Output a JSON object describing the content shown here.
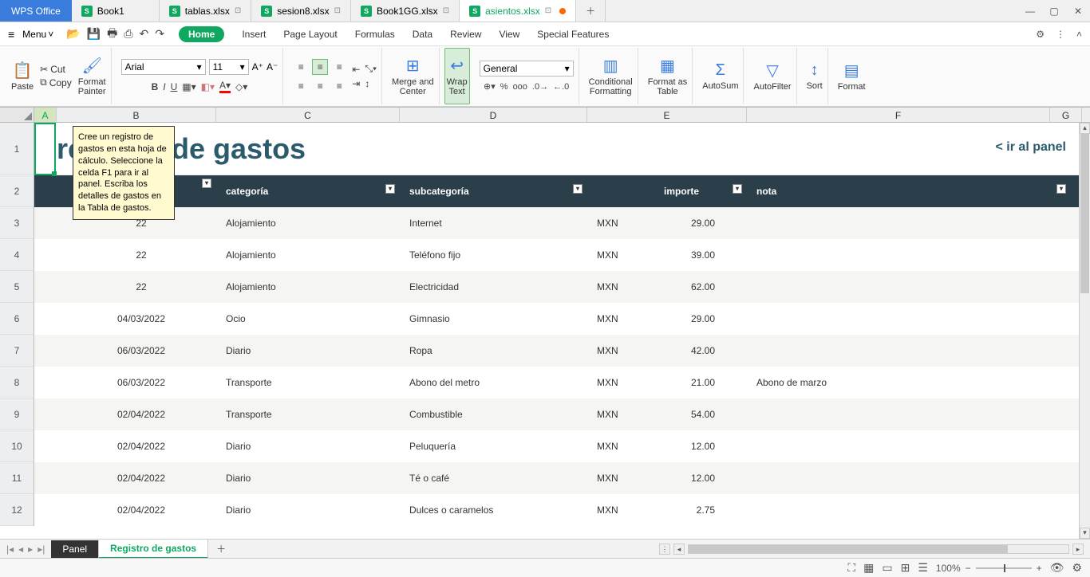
{
  "app": {
    "name": "WPS Office"
  },
  "docTabs": [
    {
      "name": "Book1",
      "pin": false
    },
    {
      "name": "tablas.xlsx",
      "pin": true
    },
    {
      "name": "sesion8.xlsx",
      "pin": true
    },
    {
      "name": "Book1GG.xlsx",
      "pin": true
    },
    {
      "name": "asientos.xlsx",
      "pin": true,
      "active": true,
      "modified": true
    }
  ],
  "menu": {
    "label": "Menu",
    "tabs": [
      "Home",
      "Insert",
      "Page Layout",
      "Formulas",
      "Data",
      "Review",
      "View",
      "Special Features"
    ]
  },
  "ribbon": {
    "paste": "Paste",
    "cut": "Cut",
    "copy": "Copy",
    "formatPainter": "Format\nPainter",
    "fontName": "Arial",
    "fontSize": "11",
    "mergeCenter": "Merge and\nCenter",
    "wrapText": "Wrap\nText",
    "numberFormat": "General",
    "condFmt": "Conditional\nFormatting",
    "formatTable": "Format as\nTable",
    "autosum": "AutoSum",
    "autofilter": "AutoFilter",
    "sort": "Sort",
    "format": "Format"
  },
  "columns": [
    "A",
    "B",
    "C",
    "D",
    "E",
    "F",
    "G"
  ],
  "rows": [
    "1",
    "2",
    "3",
    "4",
    "5",
    "6",
    "7",
    "8",
    "9",
    "10",
    "11",
    "12"
  ],
  "title": "registro de gastos",
  "panelLink": "< ir al panel",
  "headers": {
    "categoria": "categoría",
    "subcategoria": "subcategoría",
    "importe": "importe",
    "nota": "nota"
  },
  "tooltip": "Cree un registro de gastos en esta hoja de cálculo. Seleccione la celda F1 para ir al panel. Escriba los detalles de gastos en la Tabla de gastos.",
  "data": [
    {
      "fecha": "22",
      "categoria": "Alojamiento",
      "sub": "Internet",
      "cur": "MXN",
      "imp": "29.00",
      "nota": ""
    },
    {
      "fecha": "22",
      "categoria": "Alojamiento",
      "sub": "Teléfono fijo",
      "cur": "MXN",
      "imp": "39.00",
      "nota": ""
    },
    {
      "fecha": "22",
      "categoria": "Alojamiento",
      "sub": "Electricidad",
      "cur": "MXN",
      "imp": "62.00",
      "nota": ""
    },
    {
      "fecha": "04/03/2022",
      "categoria": "Ocio",
      "sub": "Gimnasio",
      "cur": "MXN",
      "imp": "29.00",
      "nota": ""
    },
    {
      "fecha": "06/03/2022",
      "categoria": "Diario",
      "sub": "Ropa",
      "cur": "MXN",
      "imp": "42.00",
      "nota": ""
    },
    {
      "fecha": "06/03/2022",
      "categoria": "Transporte",
      "sub": "Abono del metro",
      "cur": "MXN",
      "imp": "21.00",
      "nota": "Abono de marzo"
    },
    {
      "fecha": "02/04/2022",
      "categoria": "Transporte",
      "sub": "Combustible",
      "cur": "MXN",
      "imp": "54.00",
      "nota": ""
    },
    {
      "fecha": "02/04/2022",
      "categoria": "Diario",
      "sub": "Peluquería",
      "cur": "MXN",
      "imp": "12.00",
      "nota": ""
    },
    {
      "fecha": "02/04/2022",
      "categoria": "Diario",
      "sub": "Té o café",
      "cur": "MXN",
      "imp": "12.00",
      "nota": ""
    },
    {
      "fecha": "02/04/2022",
      "categoria": "Diario",
      "sub": "Dulces o caramelos",
      "cur": "MXN",
      "imp": "2.75",
      "nota": ""
    }
  ],
  "sheetTabs": {
    "panel": "Panel",
    "registro": "Registro de gastos"
  },
  "status": {
    "zoom": "100%"
  }
}
